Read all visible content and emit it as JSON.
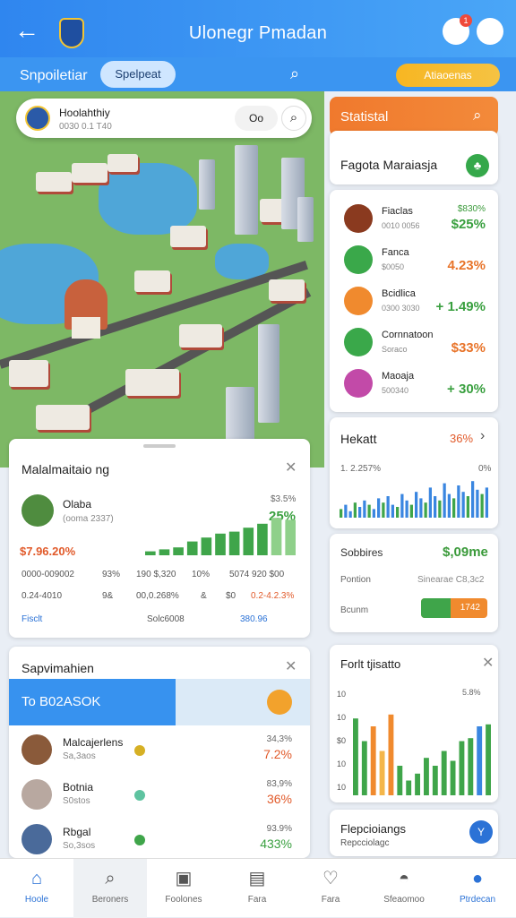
{
  "header": {
    "title": "Ulonegr Pmadan",
    "back_icon": "arrow-left-icon",
    "notification_badge": "1"
  },
  "subbar": {
    "label": "Snpoiletiar",
    "chip": "Spelpeat",
    "pill": "Atiaoenas"
  },
  "location": {
    "name": "Hoolahthiy",
    "sub": "0030 0.1 T40",
    "toggle": "Oo"
  },
  "stats_header": {
    "label": "Statistal"
  },
  "ranking": {
    "title": "Fagota Maraiasja",
    "items": [
      {
        "name": "Fiaclas",
        "sub": "0010 0056",
        "v1": "$830%",
        "v2": "$25%",
        "color": "#8a3a1f",
        "icon": "cap"
      },
      {
        "name": "Fanca",
        "sub": "$0050",
        "v1": "",
        "v2": "4.23%",
        "v2color": "#e8742a",
        "color": "#3aa84a",
        "icon": "leaf"
      },
      {
        "name": "Bcidlica",
        "sub": "0300 3030",
        "v1": "",
        "v2": "+ 1.49%",
        "color": "#f08a2e",
        "icon": "grid"
      },
      {
        "name": "Cornnatoon",
        "sub": "Soraco",
        "v1": "",
        "v2": "$33%",
        "v2color": "#e8742a",
        "color": "#3aa84a",
        "icon": "box"
      },
      {
        "name": "Maoaja",
        "sub": "500340",
        "v1": "",
        "v2": "+ 30%",
        "color": "#c24aa8",
        "icon": "grid"
      }
    ]
  },
  "hekatt": {
    "title": "Hekatt",
    "pct": "36%",
    "axis_left": "1. 2.257%",
    "axis_right": "0%",
    "bars": [
      0.2,
      0.3,
      0.15,
      0.35,
      0.25,
      0.4,
      0.3,
      0.2,
      0.45,
      0.35,
      0.5,
      0.3,
      0.25,
      0.55,
      0.4,
      0.3,
      0.6,
      0.45,
      0.35,
      0.7,
      0.5,
      0.4,
      0.8,
      0.55,
      0.45,
      0.75,
      0.6,
      0.5,
      0.85,
      0.65,
      0.55,
      0.7
    ]
  },
  "summary": {
    "label1": "Sobbires",
    "value1": "$,09me",
    "label2": "Pontion",
    "value2": "Sinearae C8,3c2",
    "label3": "Bcunm",
    "bar_value": 0.45,
    "bar_text": "1742"
  },
  "fail_chart": {
    "title": "Forlt tjisatto",
    "pct": "5.8%",
    "yticks": [
      "10",
      "10",
      "$0",
      "10",
      "10"
    ],
    "bars": [
      {
        "v": 0.78,
        "c": "#3fa54a"
      },
      {
        "v": 0.55,
        "c": "#3fa54a"
      },
      {
        "v": 0.7,
        "c": "#f08a2e"
      },
      {
        "v": 0.45,
        "c": "#f4b64a"
      },
      {
        "v": 0.82,
        "c": "#f08a2e"
      },
      {
        "v": 0.3,
        "c": "#3fa54a"
      },
      {
        "v": 0.15,
        "c": "#3fa54a"
      },
      {
        "v": 0.22,
        "c": "#3fa54a"
      },
      {
        "v": 0.38,
        "c": "#3fa54a"
      },
      {
        "v": 0.3,
        "c": "#3fa54a"
      },
      {
        "v": 0.45,
        "c": "#3fa54a"
      },
      {
        "v": 0.35,
        "c": "#3fa54a"
      },
      {
        "v": 0.55,
        "c": "#3fa54a"
      },
      {
        "v": 0.58,
        "c": "#3fa54a"
      },
      {
        "v": 0.7,
        "c": "#3a86e0"
      },
      {
        "v": 0.72,
        "c": "#3fa54a"
      }
    ]
  },
  "heplang": {
    "title": "Flepcioiangs",
    "sub": "Repcciolagc",
    "button": "Y"
  },
  "mahal": {
    "title": "Malalmaitaio  ng",
    "person": "Olaba",
    "person_sub": "(ooma 2337)",
    "pct_small": "$3.5%",
    "pct_big": "25%",
    "big_value": "$7.96.20%",
    "row1": [
      "0000-009002",
      "93%",
      "190  $,320",
      "10%",
      "5074  920  $00"
    ],
    "row2": [
      "0.24-4010",
      "9&",
      "00,0.268%",
      "&",
      "$0",
      "0.2-4.2.3%"
    ],
    "row3": [
      "Fisclt",
      "Solc6008",
      "380.96"
    ],
    "bars": [
      0.1,
      0.15,
      0.2,
      0.35,
      0.45,
      0.55,
      0.6,
      0.7,
      0.8,
      0.95,
      0.9
    ]
  },
  "sap": {
    "title": "Sapvimahien",
    "highlight": "To B02ASOK",
    "people": [
      {
        "name": "Malcajerlens",
        "sub": "Sa,3aos",
        "v1": "34,3%",
        "v2": "7.2%",
        "dot": "#d6b024",
        "avatar": "#8a5a3a"
      },
      {
        "name": "Botnia",
        "sub": "S0stos",
        "v1": "83,9%",
        "v2": "36%",
        "dot": "#5ec3a0",
        "avatar": "#b8a8a0"
      },
      {
        "name": "Rbgal",
        "sub": "So,3sos",
        "v1": "93.9%",
        "v2": "433%",
        "v2color": "#3aa040",
        "dot": "#3fa54a",
        "avatar": "#4a6a9a"
      }
    ]
  },
  "tabs": [
    {
      "label": "Hoole",
      "icon": "⌂",
      "name": "home-icon"
    },
    {
      "label": "Beroners",
      "icon": "⌕",
      "name": "search-icon"
    },
    {
      "label": "Foolones",
      "icon": "▣",
      "name": "document-icon"
    },
    {
      "label": "Fara",
      "icon": "▤",
      "name": "calendar-icon"
    },
    {
      "label": "Fara",
      "icon": "♡",
      "name": "heart-icon"
    },
    {
      "label": "Sfeaomoo",
      "icon": "◓",
      "name": "profile-icon"
    },
    {
      "label": "Ptrdecan",
      "icon": "●",
      "name": "settings-icon"
    }
  ]
}
